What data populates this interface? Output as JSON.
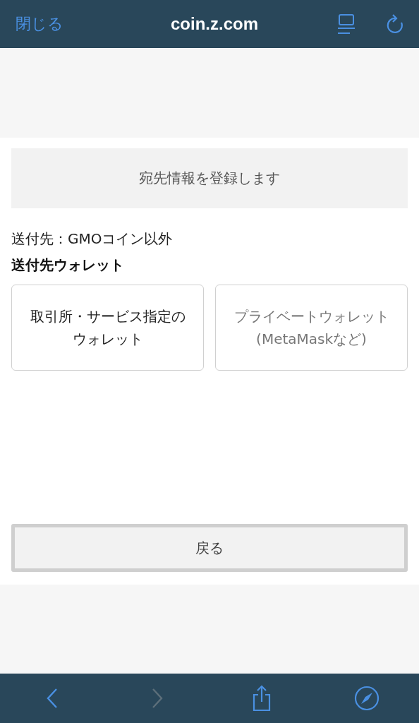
{
  "browser_bar": {
    "close": "閉じる",
    "url": "coin.z.com"
  },
  "banner": "宛先情報を登録します",
  "destination": "送付先：GMOコイン以外",
  "wallet_heading": "送付先ウォレット",
  "wallet_options": [
    {
      "lines": [
        "取引所・サービス指定の",
        "ウォレット"
      ],
      "disabled": false
    },
    {
      "lines": [
        "プライベートウォレット",
        "(MetaMaskなど)"
      ],
      "disabled": true
    }
  ],
  "back_button": "戻る",
  "toolbar": {
    "back_disabled": false,
    "forward_disabled": true
  }
}
